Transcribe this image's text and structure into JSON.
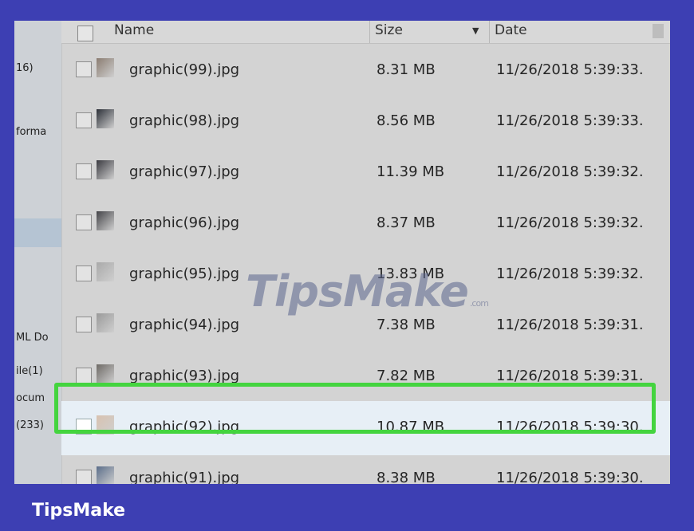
{
  "header": {
    "name": "Name",
    "size": "Size",
    "date": "Date",
    "sort_icon": "chevron-down-icon"
  },
  "nav": [
    {
      "label": "16)"
    },
    {
      "label": "forma"
    },
    {
      "label": "ML Do"
    },
    {
      "label": "ile(1)"
    },
    {
      "label": "ocum"
    },
    {
      "label": "(233)"
    }
  ],
  "files": [
    {
      "name": "graphic(99).jpg",
      "size": "8.31 MB",
      "date": "11/26/2018 5:39:33.",
      "thumb": "#8b7d72"
    },
    {
      "name": "graphic(98).jpg",
      "size": "8.56 MB",
      "date": "11/26/2018 5:39:33.",
      "thumb": "#2c3038"
    },
    {
      "name": "graphic(97).jpg",
      "size": "11.39 MB",
      "date": "11/26/2018 5:39:32.",
      "thumb": "#3a3a40"
    },
    {
      "name": "graphic(96).jpg",
      "size": "8.37 MB",
      "date": "11/26/2018 5:39:32.",
      "thumb": "#444448"
    },
    {
      "name": "graphic(95).jpg",
      "size": "13.83 MB",
      "date": "11/26/2018 5:39:32.",
      "thumb": "#a9a9a9"
    },
    {
      "name": "graphic(94).jpg",
      "size": "7.38 MB",
      "date": "11/26/2018 5:39:31.",
      "thumb": "#9a9a9a"
    },
    {
      "name": "graphic(93).jpg",
      "size": "7.82 MB",
      "date": "11/26/2018 5:39:31.",
      "thumb": "#6e6a66"
    },
    {
      "name": "graphic(92).jpg",
      "size": "10.87 MB",
      "date": "11/26/2018 5:39:30.",
      "thumb": "#d8c2b0",
      "selected": true
    },
    {
      "name": "graphic(91).jpg",
      "size": "8.38 MB",
      "date": "11/26/2018 5:39:30.",
      "thumb": "#5b6e8a"
    }
  ],
  "watermark": {
    "text": "TipsMake",
    "tld": ".com"
  },
  "brand": "TipsMake",
  "colors": {
    "highlight": "#44d43f",
    "background": "#3d3fb3",
    "selected_row": "#e7eff6"
  }
}
